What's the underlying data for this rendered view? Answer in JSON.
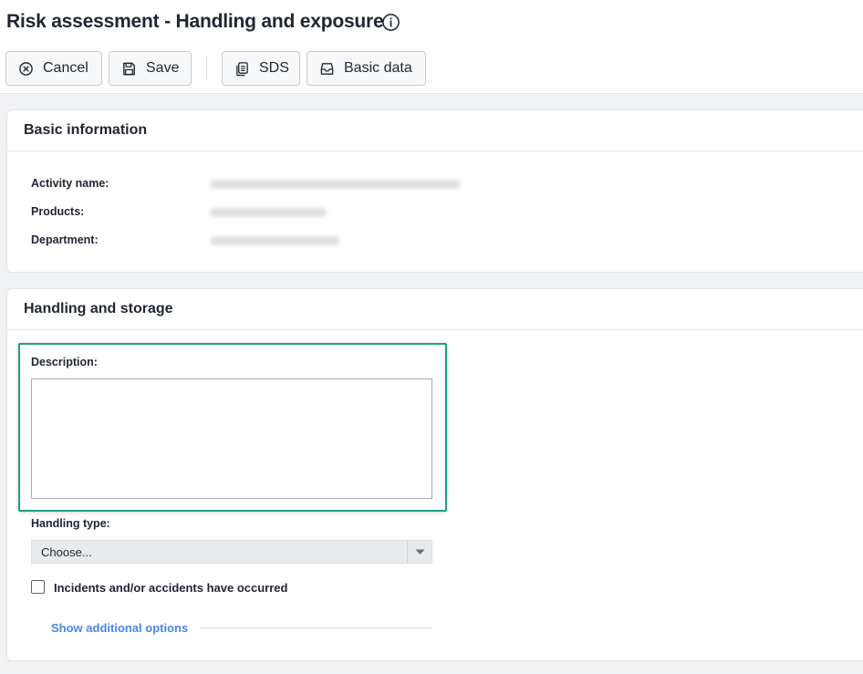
{
  "header": {
    "title": "Risk assessment - Handling and exposure",
    "info_icon": "info-circle-icon"
  },
  "toolbar": {
    "cancel_label": "Cancel",
    "cancel_icon": "close-circle-icon",
    "save_label": "Save",
    "save_icon": "floppy-disk-icon",
    "sds_label": "SDS",
    "sds_icon": "documents-icon",
    "basic_label": "Basic data",
    "basic_icon": "inbox-tray-icon"
  },
  "basic_info": {
    "title": "Basic information",
    "fields": [
      {
        "label": "Activity name:"
      },
      {
        "label": "Products:"
      },
      {
        "label": "Department:"
      }
    ]
  },
  "handling": {
    "title": "Handling and storage",
    "description_label": "Description:",
    "description_value": "",
    "handling_type_label": "Handling type:",
    "handling_type_selected": "Choose...",
    "incidents_label": "Incidents and/or accidents have occurred",
    "incidents_checked": false,
    "additional_options_link": "Show additional options"
  },
  "colors": {
    "highlight": "#1f9e82",
    "link": "#4a86e8",
    "text": "#1f2532",
    "background": "#f1f2f4"
  }
}
